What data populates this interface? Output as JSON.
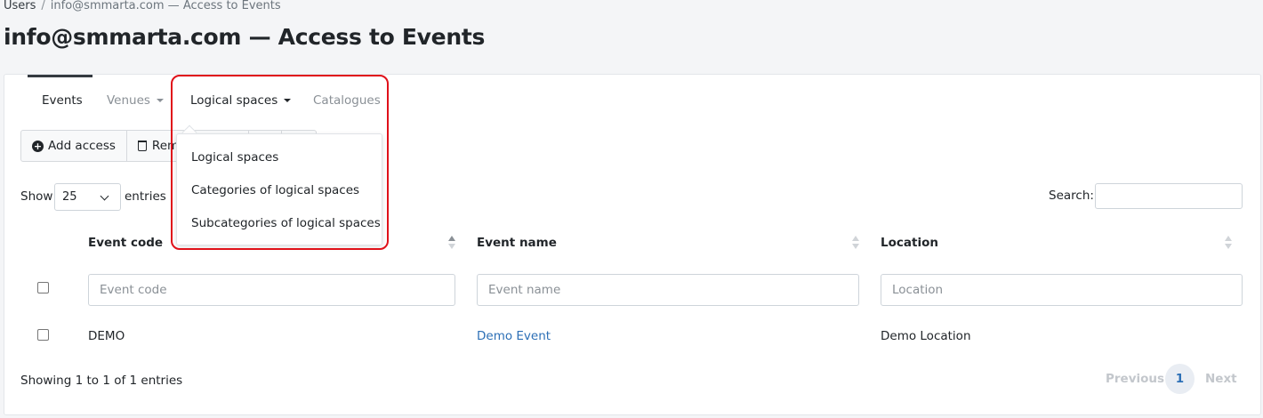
{
  "breadcrumb": {
    "root": "Users",
    "separator": "/",
    "current": "info@smmarta.com — Access to Events"
  },
  "page": {
    "title": "info@smmarta.com — Access to Events"
  },
  "tabs": [
    {
      "label": "Events",
      "active": true
    },
    {
      "label": "Venues",
      "has_dropdown": true
    },
    {
      "label": "Logical spaces",
      "has_dropdown": true,
      "open": true
    },
    {
      "label": "Catalogues"
    }
  ],
  "toolbar": {
    "add_label": "Add access",
    "remove_label": "Remo"
  },
  "length": {
    "show_label": "Show",
    "value": "25",
    "entries_label": "entries"
  },
  "search": {
    "label": "Search:"
  },
  "table": {
    "columns": [
      "Event code",
      "Event name",
      "Location"
    ],
    "filters": [
      "Event code",
      "Event name",
      "Location"
    ],
    "rows": [
      {
        "code": "DEMO",
        "name": "Demo Event",
        "location": "Demo Location"
      }
    ]
  },
  "info": "Showing 1 to 1 of 1 entries",
  "pagination": {
    "previous": "Previous",
    "current": "1",
    "next": "Next"
  },
  "dropdown": {
    "items": [
      "Logical spaces",
      "Categories of logical spaces",
      "Subcategories of logical spaces"
    ]
  },
  "colors": {
    "link": "#2c6fb6",
    "highlight": "#e0111a",
    "active_tab_line": "#343a40"
  }
}
